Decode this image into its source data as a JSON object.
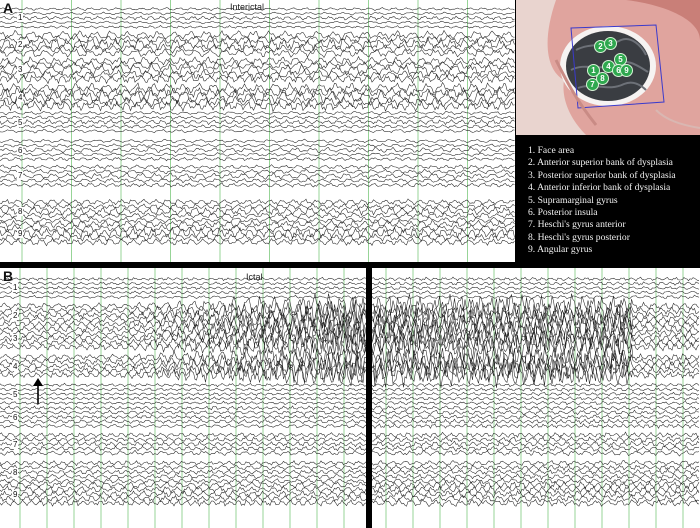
{
  "panel_a": {
    "letter": "A",
    "caption": "Interictal",
    "channel_labels": [
      "1",
      "2",
      "3",
      "4",
      "5",
      "6",
      "7",
      "8",
      "9"
    ]
  },
  "panel_b": {
    "letter": "B",
    "caption": "Ictal",
    "channel_labels": [
      "1",
      "2",
      "3",
      "4",
      "5",
      "6",
      "7",
      "8",
      "9"
    ]
  },
  "brain_photo": {
    "electrodes": [
      "1",
      "2",
      "3",
      "4",
      "5",
      "6",
      "7",
      "8",
      "9"
    ]
  },
  "legend": {
    "items": [
      "1. Face area",
      "2. Anterior superior bank of dysplasia",
      "3. Posterior superior bank of dysplasia",
      "4. Anterior inferior bank of dysplasia",
      "5. Supramarginal gyrus",
      "6. Posterior insula",
      "7. Heschi's gyrus anterior",
      "8. Heschi's gyrus posterior",
      "9. Angular gyrus"
    ]
  },
  "colors": {
    "grid": "#7dc97d",
    "trace": "#222222",
    "electrode": "#2fa84f",
    "skin": "#e0a49e",
    "cortex": "#3a3d42",
    "legend_bg": "#000000",
    "legend_text": "#f2f2f2"
  }
}
